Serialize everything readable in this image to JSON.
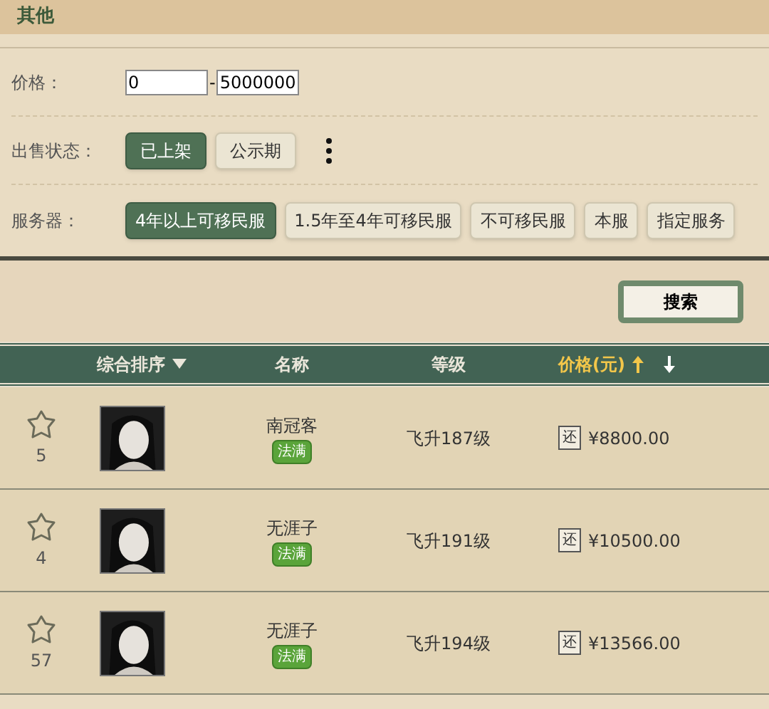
{
  "section_title": "其他",
  "price_filter": {
    "label": "价格：",
    "min": "0",
    "separator": "-",
    "max": "5000000"
  },
  "sale_status": {
    "label": "出售状态：",
    "options": [
      {
        "label": "已上架",
        "selected": true
      },
      {
        "label": "公示期",
        "selected": false
      }
    ]
  },
  "server": {
    "label": "服务器：",
    "options": [
      {
        "label": "4年以上可移民服",
        "selected": true
      },
      {
        "label": "1.5年至4年可移民服",
        "selected": false
      },
      {
        "label": "不可移民服",
        "selected": false
      },
      {
        "label": "本服",
        "selected": false
      },
      {
        "label": "指定服务",
        "selected": false
      }
    ]
  },
  "search_button": "搜索",
  "table": {
    "columns": [
      {
        "label": "综合排序",
        "kind": "dropdown",
        "highlighted": false
      },
      {
        "label": "名称",
        "kind": "plain",
        "highlighted": false
      },
      {
        "label": "等级",
        "kind": "plain",
        "highlighted": false
      },
      {
        "label": "价格(元)",
        "kind": "updown",
        "highlighted": true
      }
    ],
    "rows": [
      {
        "favorites": "5",
        "name": "南冠客",
        "tag": "法满",
        "level": "飞升187级",
        "bargain": "还",
        "price": "¥8800.00"
      },
      {
        "favorites": "4",
        "name": "无涯子",
        "tag": "法满",
        "level": "飞升191级",
        "bargain": "还",
        "price": "¥10500.00"
      },
      {
        "favorites": "57",
        "name": "无涯子",
        "tag": "法满",
        "level": "飞升194级",
        "bargain": "还",
        "price": "¥13566.00"
      }
    ]
  }
}
